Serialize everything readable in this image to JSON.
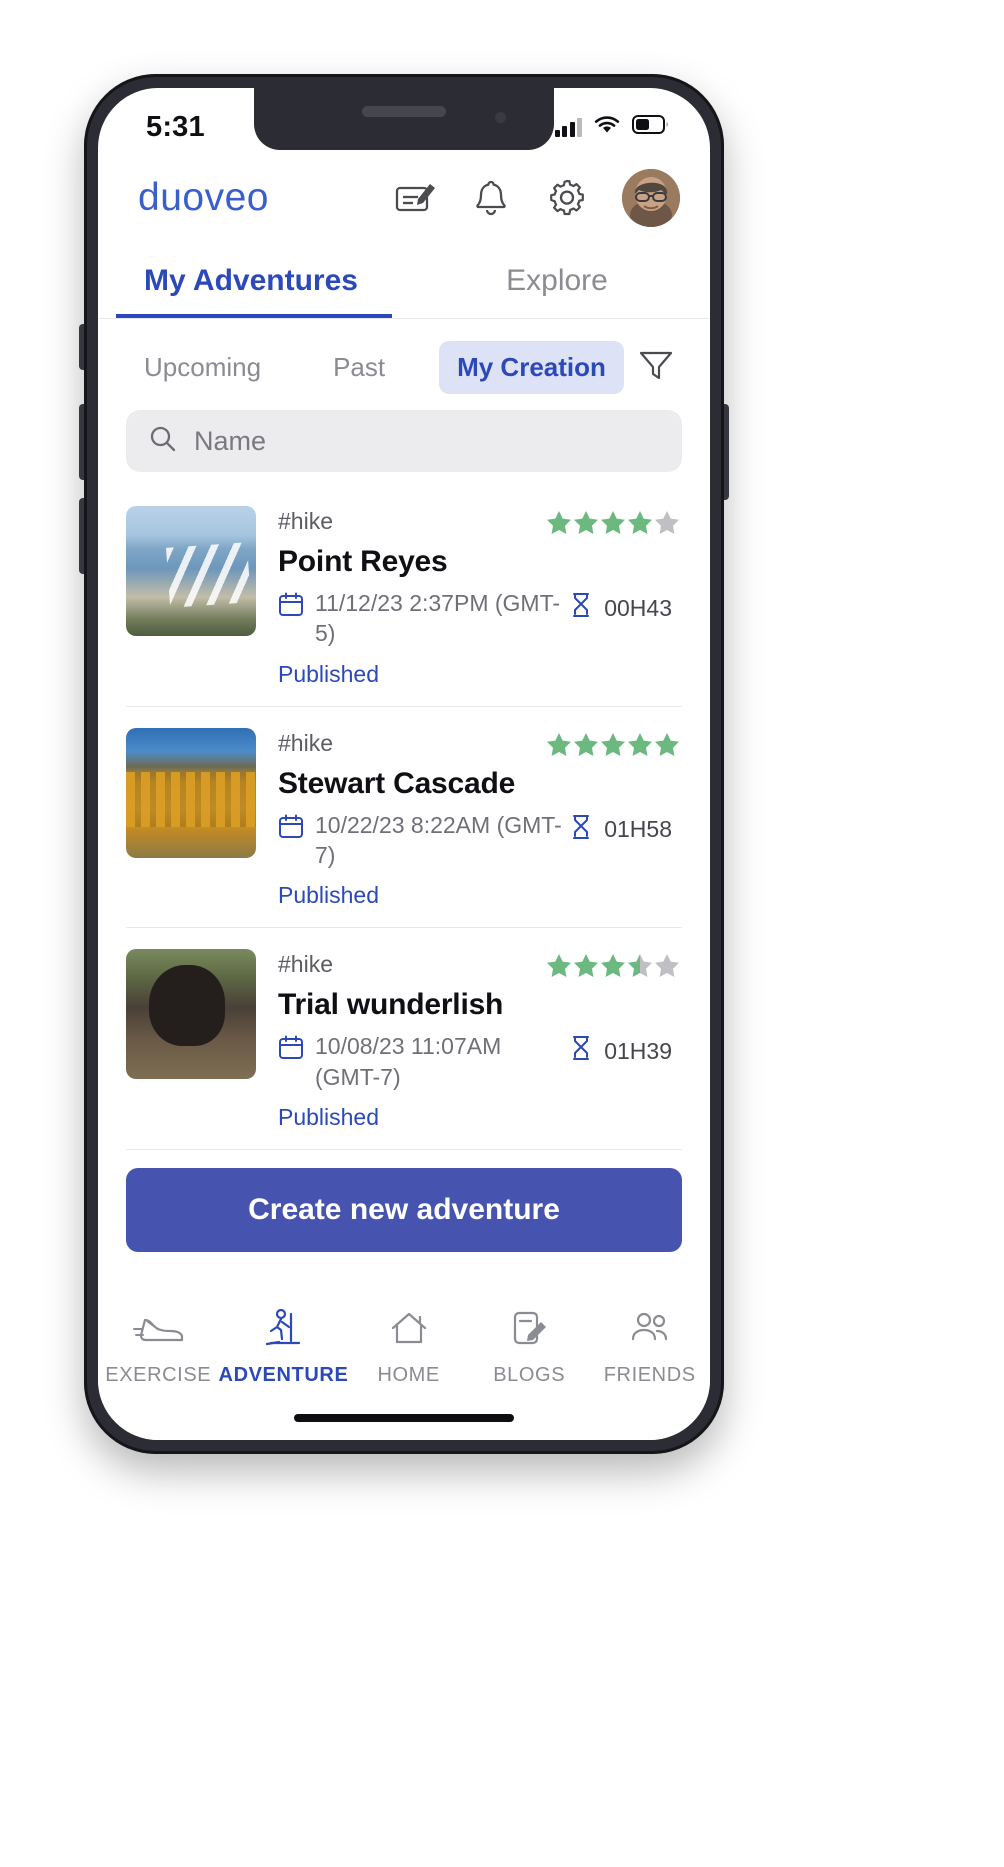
{
  "status_bar": {
    "time": "5:31",
    "signal_icon": "cellular-signal-icon",
    "wifi_icon": "wifi-icon",
    "battery_icon": "battery-icon"
  },
  "header": {
    "brand": "duoveo",
    "actions": [
      {
        "name": "compose-icon",
        "label": "Compose"
      },
      {
        "name": "bell-icon",
        "label": "Notifications"
      },
      {
        "name": "gear-icon",
        "label": "Settings"
      }
    ],
    "avatar": "user-avatar"
  },
  "main_tabs": [
    {
      "label": "My Adventures",
      "active": true
    },
    {
      "label": "Explore",
      "active": false
    }
  ],
  "filter_chips": [
    {
      "label": "Upcoming",
      "active": false
    },
    {
      "label": "Past",
      "active": false
    },
    {
      "label": "My Creation",
      "active": true
    }
  ],
  "filter_icon": "funnel-filter-icon",
  "search": {
    "icon": "search-icon",
    "placeholder": "Name",
    "value": ""
  },
  "adventures": [
    {
      "tag": "#hike",
      "title": "Point Reyes",
      "date": "11/12/23 2:37PM (GMT-5)",
      "duration": "00H43",
      "status": "Published",
      "rating": 4,
      "stars_total": 5,
      "thumb": "point-reyes-coast-photo",
      "calendar_icon": "calendar-icon",
      "duration_icon": "hourglass-icon"
    },
    {
      "tag": "#hike",
      "title": "Stewart Cascade",
      "date": "10/22/23 8:22AM (GMT-7)",
      "duration": "01H58",
      "status": "Published",
      "rating": 5,
      "stars_total": 5,
      "thumb": "stewart-cascade-aspens-photo",
      "calendar_icon": "calendar-icon",
      "duration_icon": "hourglass-icon"
    },
    {
      "tag": "#hike",
      "title": "Trial wunderlish",
      "date": "10/08/23 11:07AM (GMT-7)",
      "duration": "01H39",
      "status": "Published",
      "rating": 3.5,
      "stars_total": 5,
      "thumb": "trial-wunderlish-rock-photo",
      "calendar_icon": "calendar-icon",
      "duration_icon": "hourglass-icon"
    }
  ],
  "cta": {
    "label": "Create new adventure"
  },
  "bottom_nav": [
    {
      "label": "EXERCISE",
      "icon": "shoe-icon",
      "active": false
    },
    {
      "label": "ADVENTURE",
      "icon": "hiker-icon",
      "active": true
    },
    {
      "label": "HOME",
      "icon": "house-icon",
      "active": false
    },
    {
      "label": "BLOGS",
      "icon": "note-pencil-icon",
      "active": false
    },
    {
      "label": "FRIENDS",
      "icon": "people-icon",
      "active": false
    }
  ],
  "colors": {
    "brand_blue": "#3a5fcd",
    "accent_blue": "#2b49b8",
    "cta_blue": "#4654b0",
    "chip_active_bg": "#dde2f6",
    "star_green": "#6cb97f",
    "star_gray": "#bfbfc4",
    "muted_text": "#8b8b92"
  }
}
